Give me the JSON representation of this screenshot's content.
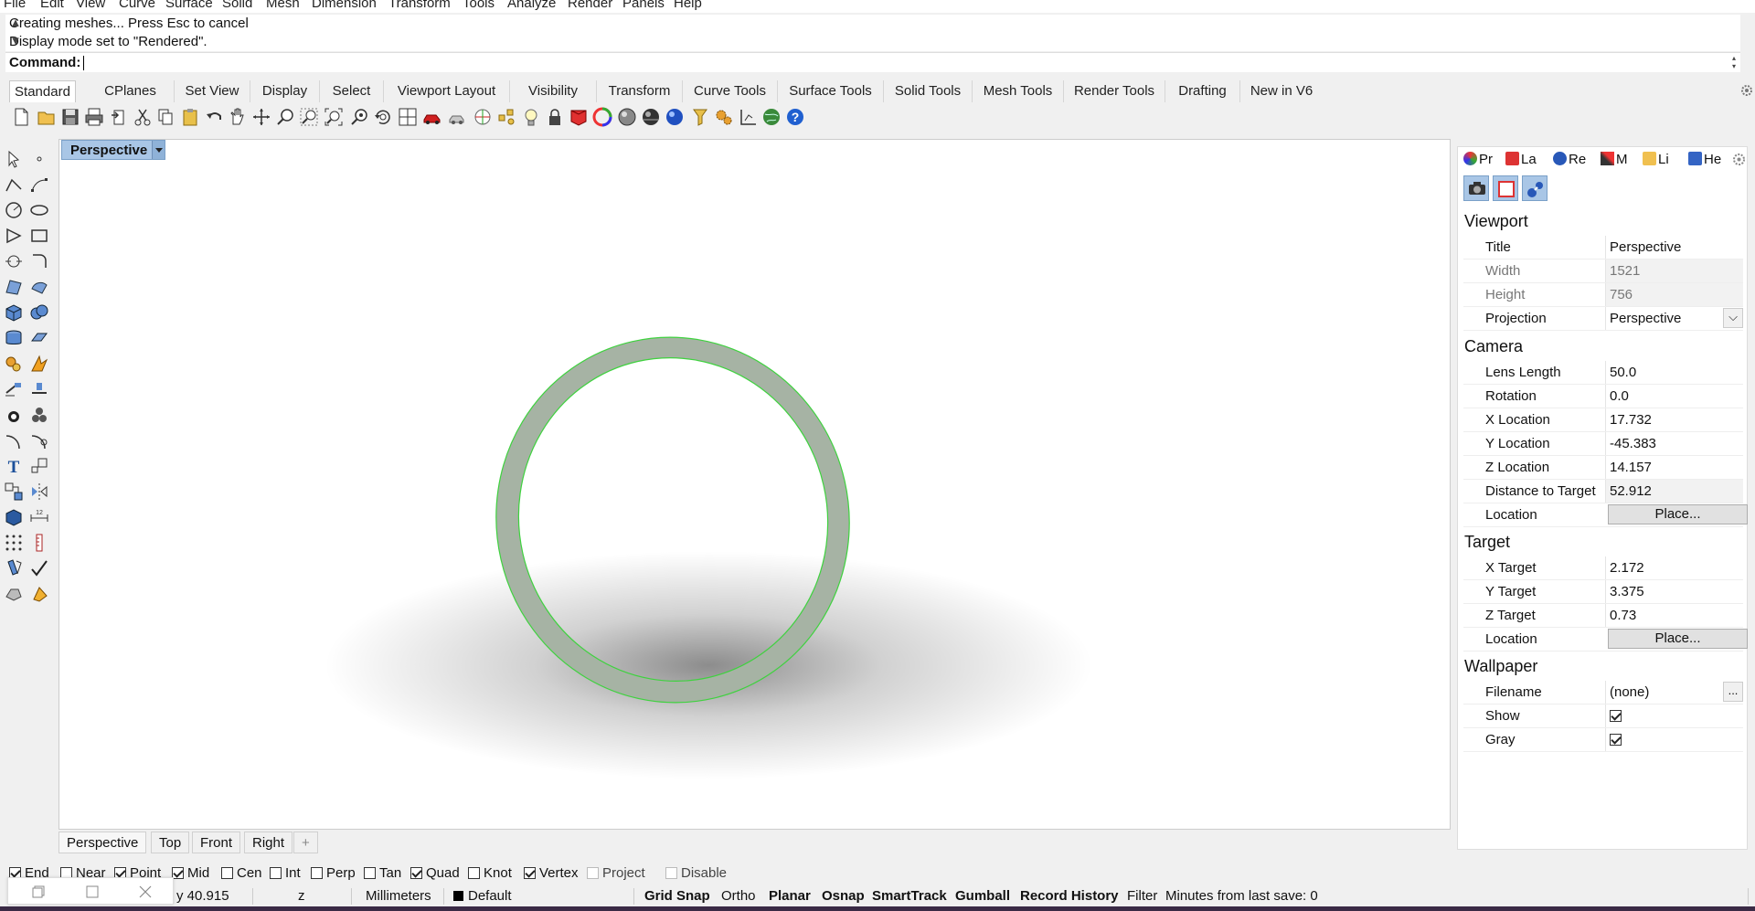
{
  "menu": [
    "File",
    "Edit",
    "View",
    "Curve",
    "Surface",
    "Solid",
    "Mesh",
    "Dimension",
    "Transform",
    "Tools",
    "Analyze",
    "Render",
    "Panels",
    "Help"
  ],
  "history": [
    "Creating meshes... Press Esc to cancel",
    "Display mode set to \"Rendered\"."
  ],
  "command": {
    "label": "Command:",
    "value": ""
  },
  "toolbar_tabs": [
    "Standard",
    "CPlanes",
    "Set View",
    "Display",
    "Select",
    "Viewport Layout",
    "Visibility",
    "Transform",
    "Curve Tools",
    "Surface Tools",
    "Solid Tools",
    "Mesh Tools",
    "Render Tools",
    "Drafting",
    "New in V6"
  ],
  "active_toolbar_tab": "Standard",
  "toolbar_icons": [
    "new-icon",
    "open-icon",
    "save-icon",
    "print-icon",
    "import-icon",
    "cut-icon",
    "copy-icon",
    "paste-icon",
    "undo-icon",
    "pan-icon",
    "move-view-icon",
    "zoom-in-icon",
    "zoom-window-icon",
    "zoom-extents-icon",
    "zoom-selected-icon",
    "rotate-view-icon",
    "four-views-icon",
    "car-icon",
    "render-preview-icon",
    "cplane-icon",
    "points-icon",
    "light-icon",
    "lock-icon",
    "material-icon",
    "color-wheel-icon",
    "shaded-sphere-icon",
    "rendered-sphere-icon",
    "blue-sphere-icon",
    "filter-icon",
    "settings-gears-icon",
    "dimension-icon",
    "globe-icon",
    "help-icon"
  ],
  "viewport": {
    "title": "Perspective"
  },
  "viewport_tabs": [
    "Perspective",
    "Top",
    "Front",
    "Right"
  ],
  "add_viewport_tab": "+",
  "osnaps": [
    {
      "label": "End",
      "checked": true
    },
    {
      "label": "Near",
      "checked": false
    },
    {
      "label": "Point",
      "checked": true
    },
    {
      "label": "Mid",
      "checked": true
    },
    {
      "label": "Cen",
      "checked": false
    },
    {
      "label": "Int",
      "checked": false
    },
    {
      "label": "Perp",
      "checked": false
    },
    {
      "label": "Tan",
      "checked": false
    },
    {
      "label": "Quad",
      "checked": true
    },
    {
      "label": "Knot",
      "checked": false
    },
    {
      "label": "Vertex",
      "checked": true
    },
    {
      "label": "Project",
      "checked": false,
      "disabled": true
    },
    {
      "label": "Disable",
      "checked": false,
      "disabled": true
    }
  ],
  "status": {
    "y": "y 40.915",
    "z": "z",
    "units": "Millimeters",
    "layer": "Default",
    "layer_color": "#000000",
    "toggles": [
      "Grid Snap",
      "Ortho",
      "Planar",
      "Osnap",
      "SmartTrack",
      "Gumball",
      "Record History",
      "Filter"
    ],
    "bold_toggles": [
      "Grid Snap",
      "Planar",
      "Osnap",
      "SmartTrack",
      "Gumball",
      "Record History"
    ],
    "save_info": "Minutes from last save: 0"
  },
  "panel": {
    "tabs": [
      "Pr",
      "La",
      "Re",
      "M",
      "Li",
      "He"
    ],
    "groups": {
      "viewport": "Viewport",
      "camera": "Camera",
      "target": "Target",
      "wallpaper": "Wallpaper"
    },
    "viewport": {
      "title_label": "Title",
      "title": "Perspective",
      "width_label": "Width",
      "width": "1521",
      "height_label": "Height",
      "height": "756",
      "projection_label": "Projection",
      "projection": "Perspective"
    },
    "camera": {
      "lens_label": "Lens Length",
      "lens": "50.0",
      "rotation_label": "Rotation",
      "rotation": "0.0",
      "x_label": "X Location",
      "x": "17.732",
      "y_label": "Y Location",
      "y": "-45.383",
      "z_label": "Z Location",
      "z": "14.157",
      "dist_label": "Distance to Target",
      "dist": "52.912",
      "location_label": "Location",
      "place": "Place..."
    },
    "target": {
      "x_label": "X Target",
      "x": "2.172",
      "y_label": "Y Target",
      "y": "3.375",
      "z_label": "Z Target",
      "z": "0.73",
      "location_label": "Location",
      "place": "Place..."
    },
    "wallpaper": {
      "filename_label": "Filename",
      "filename": "(none)",
      "browse": "...",
      "show_label": "Show",
      "show": true,
      "gray_label": "Gray",
      "gray": true
    }
  },
  "colors": {
    "ring_fill": "#a6b3a4",
    "ring_edge": "#3fd23f",
    "viewport_title_bg": "#a9c6e6"
  }
}
